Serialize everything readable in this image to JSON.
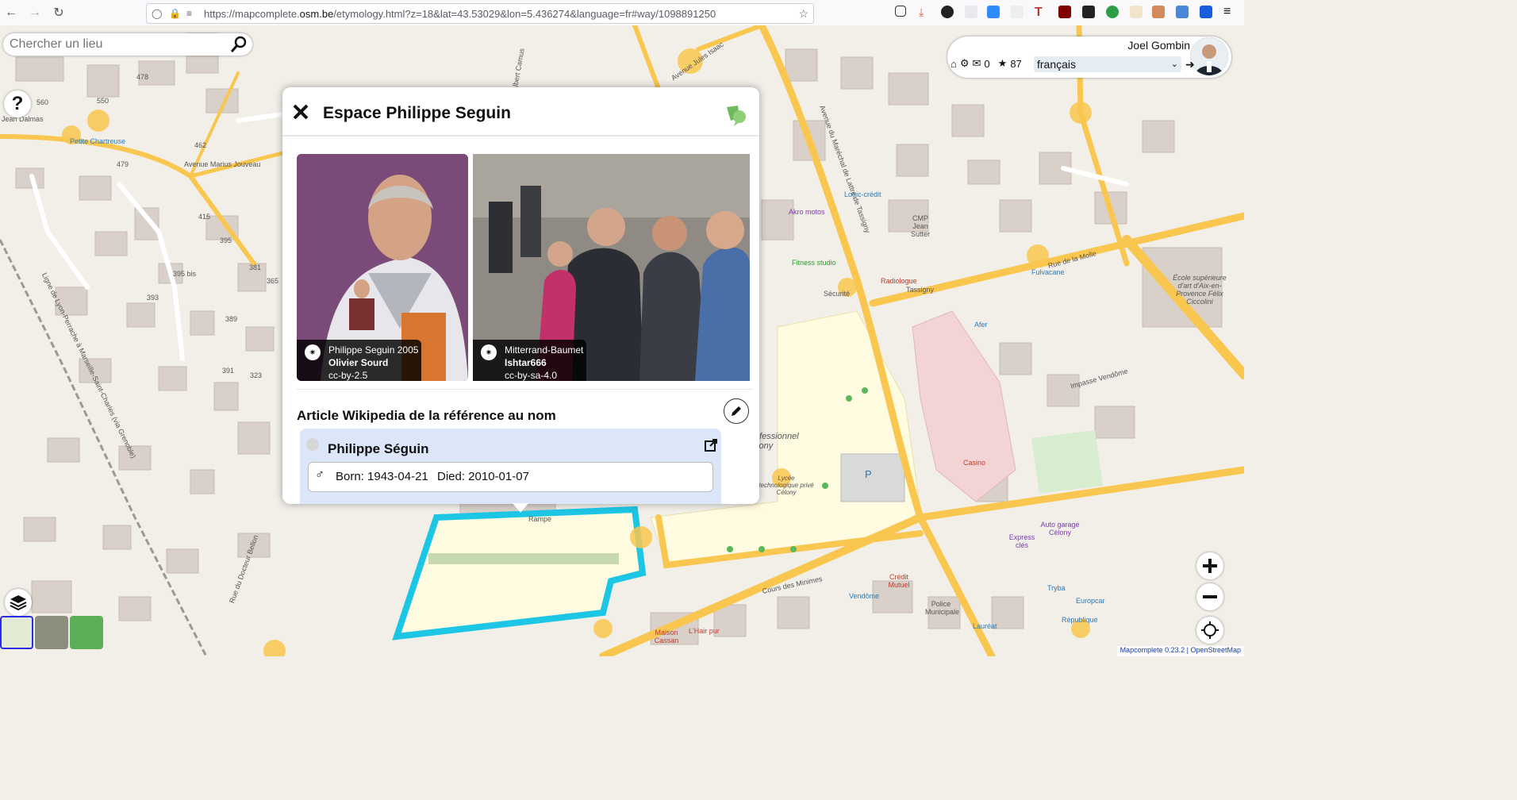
{
  "browser": {
    "url_prefix": "https://mapcomplete.",
    "url_domain": "osm.be",
    "url_suffix": "/etymology.html?z=18&lat=43.53029&lon=5.436274&language=fr#way/1098891250"
  },
  "search": {
    "placeholder": "Chercher un lieu"
  },
  "help": {
    "label": "?"
  },
  "user": {
    "name": "Joel Gombin",
    "messages": "0",
    "score": "87",
    "language": "français"
  },
  "map_labels": [
    "Avenue Jules Isaac",
    "Rue Albert Camus",
    "Avenue Marius Jouveau",
    "Jean Dalmas",
    "Petite Chartreuse",
    "Logic-crédit",
    "Akro motos",
    "CMP Jean Sutter",
    "Fitness studio",
    "Radiologue",
    "Sécurité",
    "Tassigny",
    "Rue de la Molle",
    "Fulvacane",
    "Afer",
    "École supérieure d'art d'Aix-en-Provence Félix Ciccolini",
    "Impasse Vendôme",
    "Casino",
    "Rampe",
    "Crédit Mutuel",
    "Vendôme",
    "Police Municipale",
    "Maison Cassan",
    "L'Hair pur",
    "Lauréat",
    "Express clés",
    "Auto garage Célony",
    "Europcar",
    "Tryba",
    "République",
    "Cours des Minimes",
    "Lycée technologique privé Célony",
    "Professionnel Célony",
    "Ligne de Lyon-Perrache à Marseille-Saint-Charles (via Grenoble)",
    "Rue du Docteur Bellon",
    "Avenue du Maréchal de Lattre de Tassigny",
    "P",
    "478",
    "560",
    "550",
    "462",
    "479",
    "415",
    "395",
    "381",
    "365",
    "393",
    "389",
    "391",
    "323",
    "395 bis"
  ],
  "popup": {
    "title": "Espace Philippe Seguin",
    "images": [
      {
        "title": "Philippe Seguin 2005",
        "author": "Olivier Sourd",
        "license": "cc-by-2.5"
      },
      {
        "title": "Mitterrand-Baumet",
        "author": "Ishtar666",
        "license": "cc-by-sa-4.0"
      }
    ],
    "wiki_heading": "Article Wikipedia de la référence au nom",
    "wiki": {
      "title": "Philippe Séguin",
      "born": "Born: 1943-04-21",
      "died": "Died: 2010-01-07"
    }
  },
  "attribution": "Mapcomplete 0.23.2 | OpenStreetMap",
  "colors": {
    "road": "#f9c74f",
    "highlight": "#1ec6e6",
    "building": "#d9d0c9"
  }
}
